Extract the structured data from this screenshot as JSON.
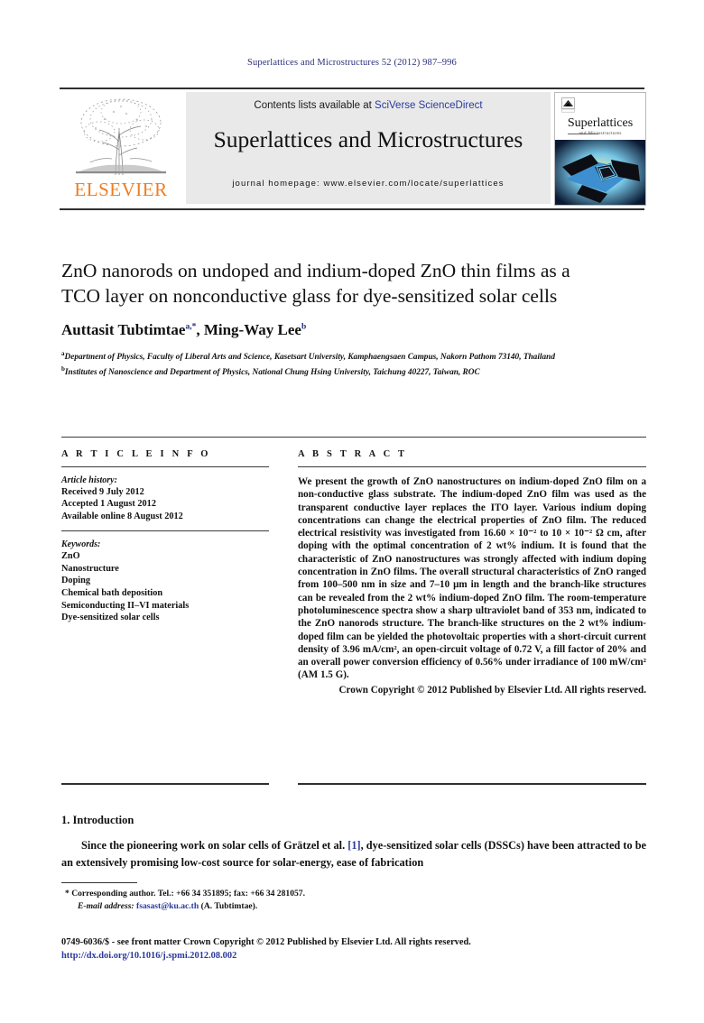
{
  "running_head": "Superlattices and Microstructures 52 (2012) 987–996",
  "masthead": {
    "publisher_name": "ELSEVIER",
    "contents_prefix": "Contents lists available at ",
    "contents_link": "SciVerse ScienceDirect",
    "journal_title": "Superlattices and Microstructures",
    "homepage_label": "journal homepage: www.elsevier.com/locate/superlattices",
    "cover": {
      "title": "Superlattices",
      "subtitle": "and Microstructures"
    }
  },
  "article": {
    "title": "ZnO nanorods on undoped and indium-doped ZnO thin films as a TCO layer on nonconductive glass for dye-sensitized solar cells",
    "authors": [
      {
        "name": "Auttasit Tubtimtae",
        "marks": "a,*"
      },
      {
        "name": "Ming-Way Lee",
        "marks": "b"
      }
    ],
    "affiliations": [
      {
        "mark": "a",
        "text": "Department of Physics, Faculty of Liberal Arts and Science, Kasetsart University, Kamphaengsaen Campus, Nakorn Pathom 73140, Thailand"
      },
      {
        "mark": "b",
        "text": "Institutes of Nanoscience and Department of Physics, National Chung Hsing University, Taichung 40227, Taiwan, ROC"
      }
    ]
  },
  "article_info": {
    "heading": "A R T I C L E  I N F O",
    "history_label": "Article history:",
    "history": [
      "Received 9 July 2012",
      "Accepted 1 August 2012",
      "Available online 8 August 2012"
    ],
    "keywords_label": "Keywords:",
    "keywords": [
      "ZnO",
      "Nanostructure",
      "Doping",
      "Chemical bath deposition",
      "Semiconducting II–VI materials",
      "Dye-sensitized solar cells"
    ]
  },
  "abstract": {
    "heading": "A B S T R A C T",
    "text": "We present the growth of ZnO nanostructures on indium-doped ZnO film on a non-conductive glass substrate. The indium-doped ZnO film was used as the transparent conductive layer replaces the ITO layer. Various indium doping concentrations can change the electrical properties of ZnO film. The reduced electrical resistivity was investigated from 16.60 × 10⁻² to 10 × 10⁻² Ω cm, after doping with the optimal concentration of 2 wt% indium. It is found that the characteristic of ZnO nanostructures was strongly affected with indium doping concentration in ZnO films. The overall structural characteristics of ZnO ranged from 100–500 nm in size and 7–10 μm in length and the branch-like structures can be revealed from the 2 wt% indium-doped ZnO film. The room-temperature photoluminescence spectra show a sharp ultraviolet band of 353 nm, indicated to the ZnO nanorods structure. The branch-like structures on the 2 wt% indium-doped film can be yielded the photovoltaic properties with a short-circuit current density of 3.96 mA/cm², an open-circuit voltage of 0.72 V, a fill factor of 20% and an overall power conversion efficiency of 0.56% under irradiance of 100 mW/cm² (AM 1.5 G).",
    "copyright": "Crown Copyright © 2012 Published by Elsevier Ltd. All rights reserved."
  },
  "introduction": {
    "heading": "1. Introduction",
    "paragraph_part1": "Since the pioneering work on solar cells of Grätzel et al. ",
    "reference_mark": "[1]",
    "paragraph_part2": ", dye-sensitized solar cells (DSSCs) have been attracted to be an extensively promising low-cost source for solar-energy, ease of fabrication"
  },
  "footnotes": {
    "corresponding": "* Corresponding author. Tel.: +66 34 351895; fax: +66 34 281057.",
    "email_label": "E-mail address:",
    "email": "fsasast@ku.ac.th",
    "email_suffix": "(A. Tubtimtae).",
    "imprint": "0749-6036/$ - see front matter Crown Copyright © 2012 Published by Elsevier Ltd. All rights reserved.",
    "doi": "http://dx.doi.org/10.1016/j.spmi.2012.08.002"
  },
  "colors": {
    "link_blue": "#2b3a9b",
    "running_head_blue": "#2b2f7a",
    "elsevier_orange": "#f07d20",
    "panel_gray": "#e9e9e9"
  }
}
